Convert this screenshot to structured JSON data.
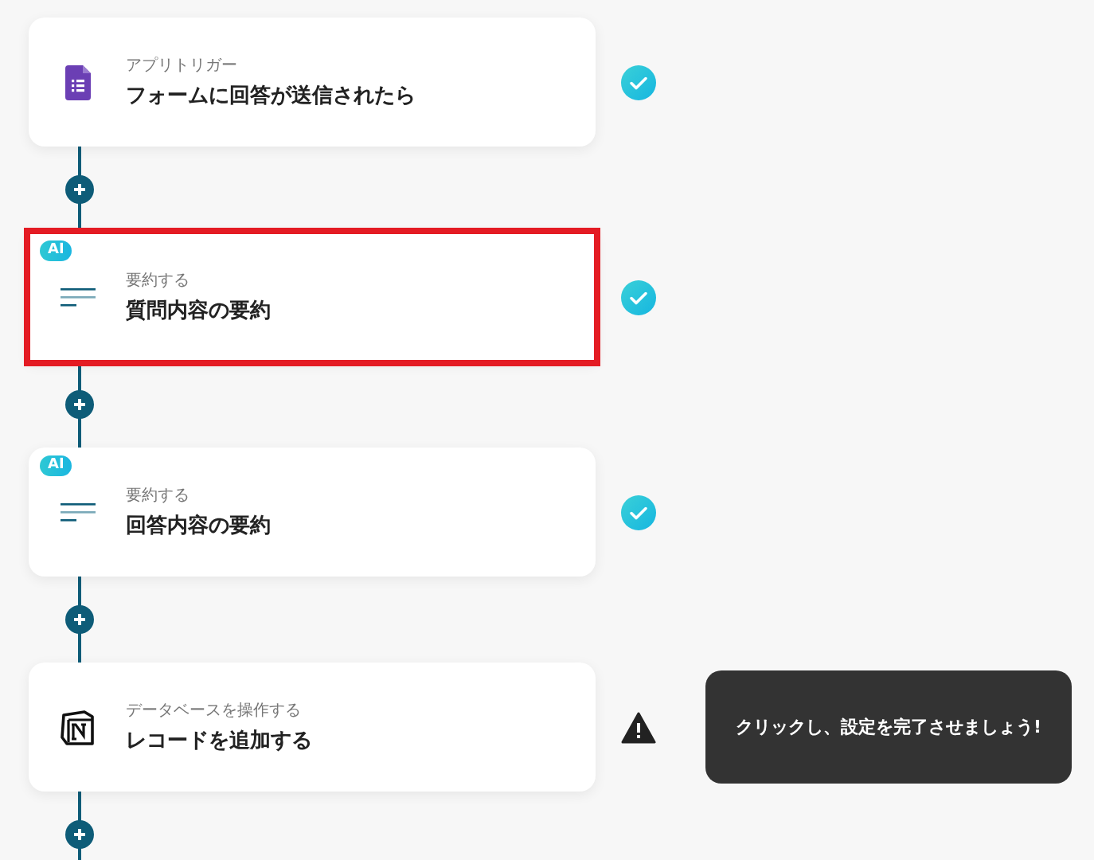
{
  "steps": [
    {
      "kind": "forms",
      "ai": false,
      "highlighted": false,
      "label": "アプリトリガー",
      "title": "フォームに回答が送信されたら",
      "complete": true
    },
    {
      "kind": "summary",
      "ai": true,
      "badge": "AI",
      "highlighted": true,
      "label": "要約する",
      "title": "質問内容の要約",
      "complete": true
    },
    {
      "kind": "summary",
      "ai": true,
      "badge": "AI",
      "highlighted": false,
      "label": "要約する",
      "title": "回答内容の要約",
      "complete": true
    },
    {
      "kind": "notion",
      "ai": false,
      "highlighted": false,
      "label": "データベースを操作する",
      "title": "レコードを追加する",
      "complete": false,
      "tooltip": "クリックし、設定を完了させましょう!"
    }
  ]
}
